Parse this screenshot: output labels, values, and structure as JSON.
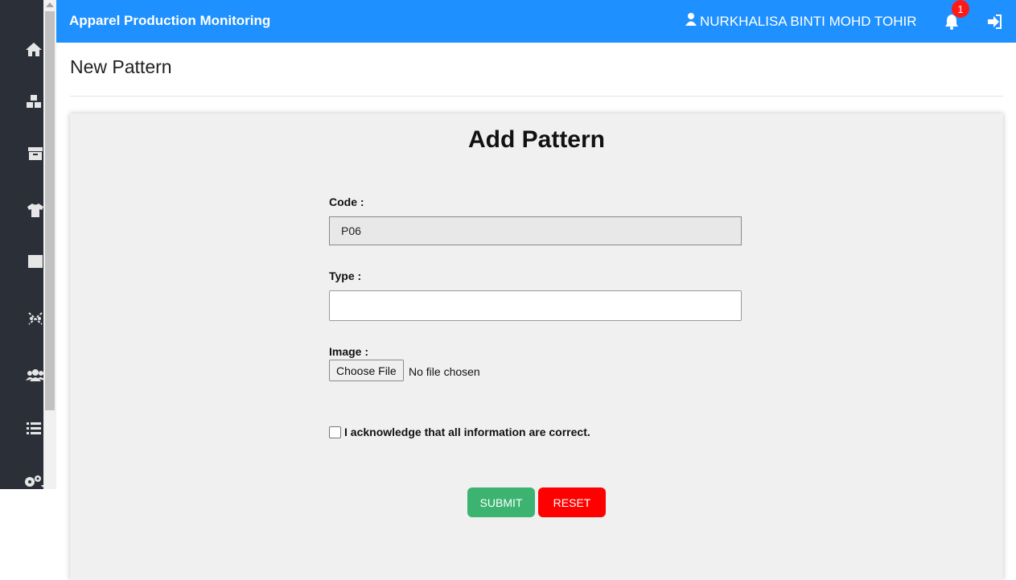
{
  "app": {
    "title": "Apparel Production Monitoring"
  },
  "topbar": {
    "user_name": "NURKHALISA BINTI MOHD TOHIR",
    "notification_count": "1",
    "icons": [
      "user-icon",
      "bell-icon",
      "logout-icon"
    ],
    "color": "#1e90ff"
  },
  "sidebar": {
    "icons": [
      "home-icon",
      "boxes-icon",
      "archive-icon",
      "tshirt-icon",
      "square-icon",
      "pattern-icon",
      "users-icon",
      "list-icon",
      "gears-icon"
    ]
  },
  "page": {
    "title": "New Pattern"
  },
  "form": {
    "title": "Add Pattern",
    "code_label": "Code :",
    "code_value": "P06",
    "type_label": "Type :",
    "type_value": "",
    "image_label": "Image :",
    "file_button": "Choose File",
    "file_status": "No file chosen",
    "ack_label": "I acknowledge that all information are correct.",
    "submit_label": "SUBMIT",
    "reset_label": "RESET",
    "submit_color": "#3cb371",
    "reset_color": "#ff0000"
  }
}
